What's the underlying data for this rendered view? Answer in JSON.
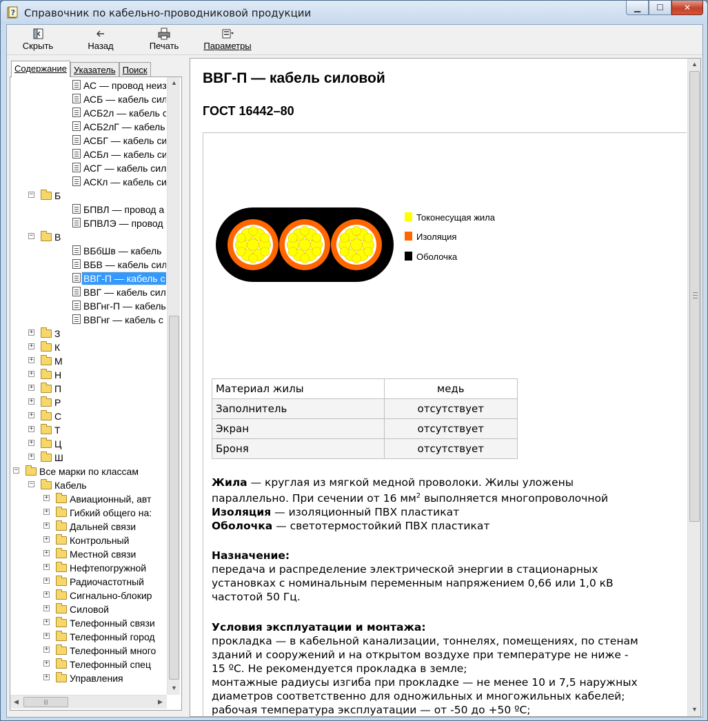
{
  "window": {
    "title": "Справочник по кабельно-проводниковой продукции",
    "controls": {
      "minimize": "▁",
      "maximize": "☐",
      "close": "✕"
    }
  },
  "toolbar": {
    "hide_label": "Скрыть",
    "back_label": "Назад",
    "print_label": "Печать",
    "options_label": "Параметры"
  },
  "tabs": [
    "Содержание",
    "Указатель",
    "Поиск"
  ],
  "tree": {
    "items": [
      {
        "label": "АС — провод неиз",
        "kind": "doc"
      },
      {
        "label": "АСБ — кабель сил",
        "kind": "doc"
      },
      {
        "label": "АСБ2л — кабель с",
        "kind": "doc"
      },
      {
        "label": "АСБ2лГ — кабель",
        "kind": "doc"
      },
      {
        "label": "АСБГ — кабель си",
        "kind": "doc"
      },
      {
        "label": "АСБл — кабель си",
        "kind": "doc"
      },
      {
        "label": "АСГ — кабель сил",
        "kind": "doc"
      },
      {
        "label": "АСКл — кабель си",
        "kind": "doc"
      },
      {
        "label": "Б",
        "kind": "folder",
        "expander": "−"
      },
      {
        "label": "БПВЛ — провод а",
        "kind": "doc"
      },
      {
        "label": "БПВЛЭ — провод",
        "kind": "doc"
      },
      {
        "label": "В",
        "kind": "folder",
        "expander": "−"
      },
      {
        "label": "ВБбШв — кабель",
        "kind": "doc"
      },
      {
        "label": "ВБВ — кабель сил",
        "kind": "doc"
      },
      {
        "label": "ВВГ-П — кабель с",
        "kind": "doc",
        "selected": true
      },
      {
        "label": "ВВГ — кабель сил",
        "kind": "doc"
      },
      {
        "label": "ВВГнг-П — кабель",
        "kind": "doc"
      },
      {
        "label": "ВВГнг — кабель с",
        "kind": "doc"
      },
      {
        "label": "З",
        "kind": "folder",
        "expander": "+"
      },
      {
        "label": "К",
        "kind": "folder",
        "expander": "+"
      },
      {
        "label": "М",
        "kind": "folder",
        "expander": "+"
      },
      {
        "label": "Н",
        "kind": "folder",
        "expander": "+"
      },
      {
        "label": "П",
        "kind": "folder",
        "expander": "+"
      },
      {
        "label": "Р",
        "kind": "folder",
        "expander": "+"
      },
      {
        "label": "С",
        "kind": "folder",
        "expander": "+"
      },
      {
        "label": "Т",
        "kind": "folder",
        "expander": "+"
      },
      {
        "label": "Ц",
        "kind": "folder",
        "expander": "+"
      },
      {
        "label": "Ш",
        "kind": "folder",
        "expander": "+"
      },
      {
        "label": "Все марки по классам",
        "kind": "folder",
        "expander": "−"
      },
      {
        "label": "Кабель",
        "kind": "folder",
        "expander": "−"
      },
      {
        "label": "Авиационный, авт",
        "kind": "folder",
        "expander": "+"
      },
      {
        "label": "Гибкий общего на:",
        "kind": "folder",
        "expander": "+"
      },
      {
        "label": "Дальней связи",
        "kind": "folder",
        "expander": "+"
      },
      {
        "label": "Контрольный",
        "kind": "folder",
        "expander": "+"
      },
      {
        "label": "Местной связи",
        "kind": "folder",
        "expander": "+"
      },
      {
        "label": "Нефтепогружной",
        "kind": "folder",
        "expander": "+"
      },
      {
        "label": "Радиочастотный",
        "kind": "folder",
        "expander": "+"
      },
      {
        "label": "Сигнально-блокир",
        "kind": "folder",
        "expander": "+"
      },
      {
        "label": "Силовой",
        "kind": "folder",
        "expander": "+"
      },
      {
        "label": "Телефонный связи",
        "kind": "folder",
        "expander": "+"
      },
      {
        "label": "Телефонный город",
        "kind": "folder",
        "expander": "+"
      },
      {
        "label": "Телефонный много",
        "kind": "folder",
        "expander": "+"
      },
      {
        "label": "Телефонный спец",
        "kind": "folder",
        "expander": "+"
      },
      {
        "label": "Управления",
        "kind": "folder",
        "expander": "+"
      }
    ]
  },
  "article": {
    "title": "ВВГ-П — кабель силовой",
    "gost": "ГОСТ 16442–80",
    "legend": [
      {
        "label": "Токонесущая жила",
        "color": "#ffff00"
      },
      {
        "label": "Изоляция",
        "color": "#ff6600"
      },
      {
        "label": "Оболочка",
        "color": "#000000"
      }
    ],
    "props": [
      {
        "name": "Материал жилы",
        "value": "медь"
      },
      {
        "name": "Заполнитель",
        "value": "отсутствует"
      },
      {
        "name": "Экран",
        "value": "отсутствует"
      },
      {
        "name": "Броня",
        "value": "отсутствует"
      }
    ],
    "core_label": "Жила",
    "core_text": " — круглая из мягкой медной проволоки. Жилы уложены",
    "core_text2": "параллельно. При сечении от 16 мм",
    "core_sup": "2",
    "core_text3": " выполняется многопроволочной",
    "insulation_label": "Изоляция",
    "insulation_text": " — изоляционный ПВХ пластикат",
    "sheath_label": "Оболочка",
    "sheath_text": " — светотермостойкий ПВХ пластикат",
    "purpose_label": "Назначение:",
    "purpose_lines": [
      "передача и распределение электрической энергии в стационарных",
      "установках с номинальным переменным напряжением 0,66 или 1,0 кВ",
      "частотой 50 Гц."
    ],
    "conditions_label": "Условия эксплуатации и монтажа:",
    "conditions_lines": [
      "прокладка — в кабельной канализации, тоннелях, помещениях, по стенам",
      "зданий и сооружений и на открытом воздухе при температуре не ниже -",
      "15 ºС. Не рекомендуется прокладка в земле;",
      "монтажные радиусы изгиба при прокладке — не менее 10 и 7,5 наружных",
      "диаметров соответственно для одножильных и многожильных кабелей;",
      "рабочая температура эксплуатации — от -50 до +50 ºС;"
    ]
  }
}
